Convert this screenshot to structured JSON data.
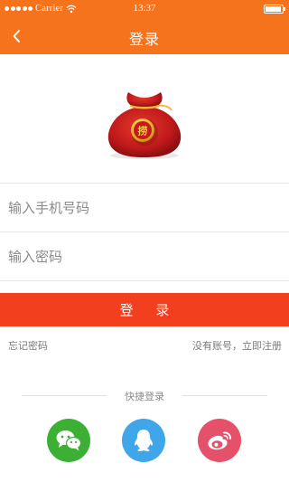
{
  "status_bar": {
    "carrier": "Carrier",
    "time": "13:37"
  },
  "nav": {
    "title": "登录"
  },
  "logo": {
    "text": "捞"
  },
  "form": {
    "phone_placeholder": "输入手机号码",
    "password_placeholder": "输入密码",
    "login_label": "登 录"
  },
  "links": {
    "forgot": "忘记密码",
    "register": "没有账号，立即注册"
  },
  "quick_login": {
    "label": "快捷登录",
    "providers": [
      "wechat",
      "qq",
      "weibo"
    ]
  },
  "colors": {
    "header": "#f5731c",
    "login_button": "#f23f1d",
    "wechat": "#3cb034",
    "qq": "#3fa6e9",
    "weibo": "#e5506a"
  }
}
